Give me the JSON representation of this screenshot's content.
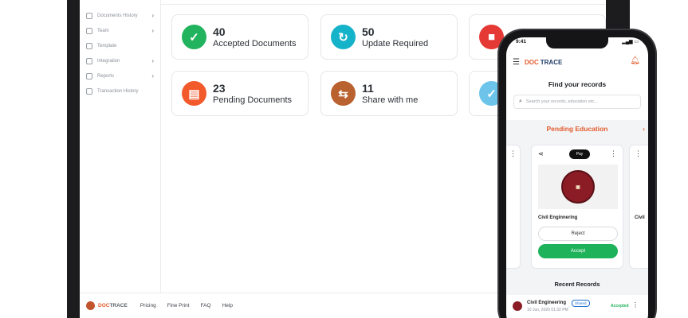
{
  "sidebar": {
    "items": [
      {
        "label": "Documents History",
        "icon": "documents-icon",
        "chevron": "›"
      },
      {
        "label": "Team",
        "icon": "team-icon",
        "chevron": "›"
      },
      {
        "label": "Template",
        "icon": "template-icon",
        "chevron": ""
      },
      {
        "label": "Integration",
        "icon": "integration-icon",
        "chevron": "›"
      },
      {
        "label": "Reports",
        "icon": "reports-icon",
        "chevron": "›"
      },
      {
        "label": "Transaction History",
        "icon": "history-icon",
        "chevron": ""
      }
    ]
  },
  "dashboard": {
    "cards": [
      {
        "count": "40",
        "label": "Accepted Documents",
        "color": "#22b35e",
        "icon": "document-check-icon",
        "glyph": "✓"
      },
      {
        "count": "50",
        "label": "Update Required",
        "color": "#15b3c9",
        "icon": "refresh-icon",
        "glyph": "↻"
      },
      {
        "count": "23",
        "label": "Pending Documents",
        "color": "#f25a2c",
        "icon": "pending-document-icon",
        "glyph": "▤"
      },
      {
        "count": "11",
        "label": "Share with me",
        "color": "#b9612f",
        "icon": "share-users-icon",
        "glyph": "⇆"
      }
    ],
    "partial_cards": [
      {
        "color": "#e53935",
        "icon": "rejected-document-icon"
      },
      {
        "color": "#6cc4ea",
        "icon": "calendar-check-icon"
      }
    ]
  },
  "footer": {
    "brand_part1": "DOC",
    "brand_part2": "TRACE",
    "links": [
      "Pricing",
      "Fine Print",
      "FAQ",
      "Help"
    ]
  },
  "phone": {
    "status_time": "9:41",
    "brand_part1": "DOC",
    "brand_part2": "TRACE",
    "find_title": "Find your records",
    "search_placeholder": "Search your records, education etc...",
    "pending_title": "Pending Education",
    "card": {
      "pay_label": "Pay",
      "course": "Civil Enginnering",
      "reject_label": "Reject",
      "accept_label": "Accept"
    },
    "peek_left": {
      "course": ""
    },
    "peek_right": {
      "course": "Civil"
    },
    "recent_title": "Recent Records",
    "recent": [
      {
        "name": "Civil Engineering",
        "badge": "Shared",
        "date": "10 Jun, 2020 01:32 PM",
        "status": "Accepted"
      }
    ]
  },
  "colors": {
    "brand_orange": "#e25b2c",
    "brand_navy": "#1f3c67",
    "accept_green": "#1eb25a"
  }
}
